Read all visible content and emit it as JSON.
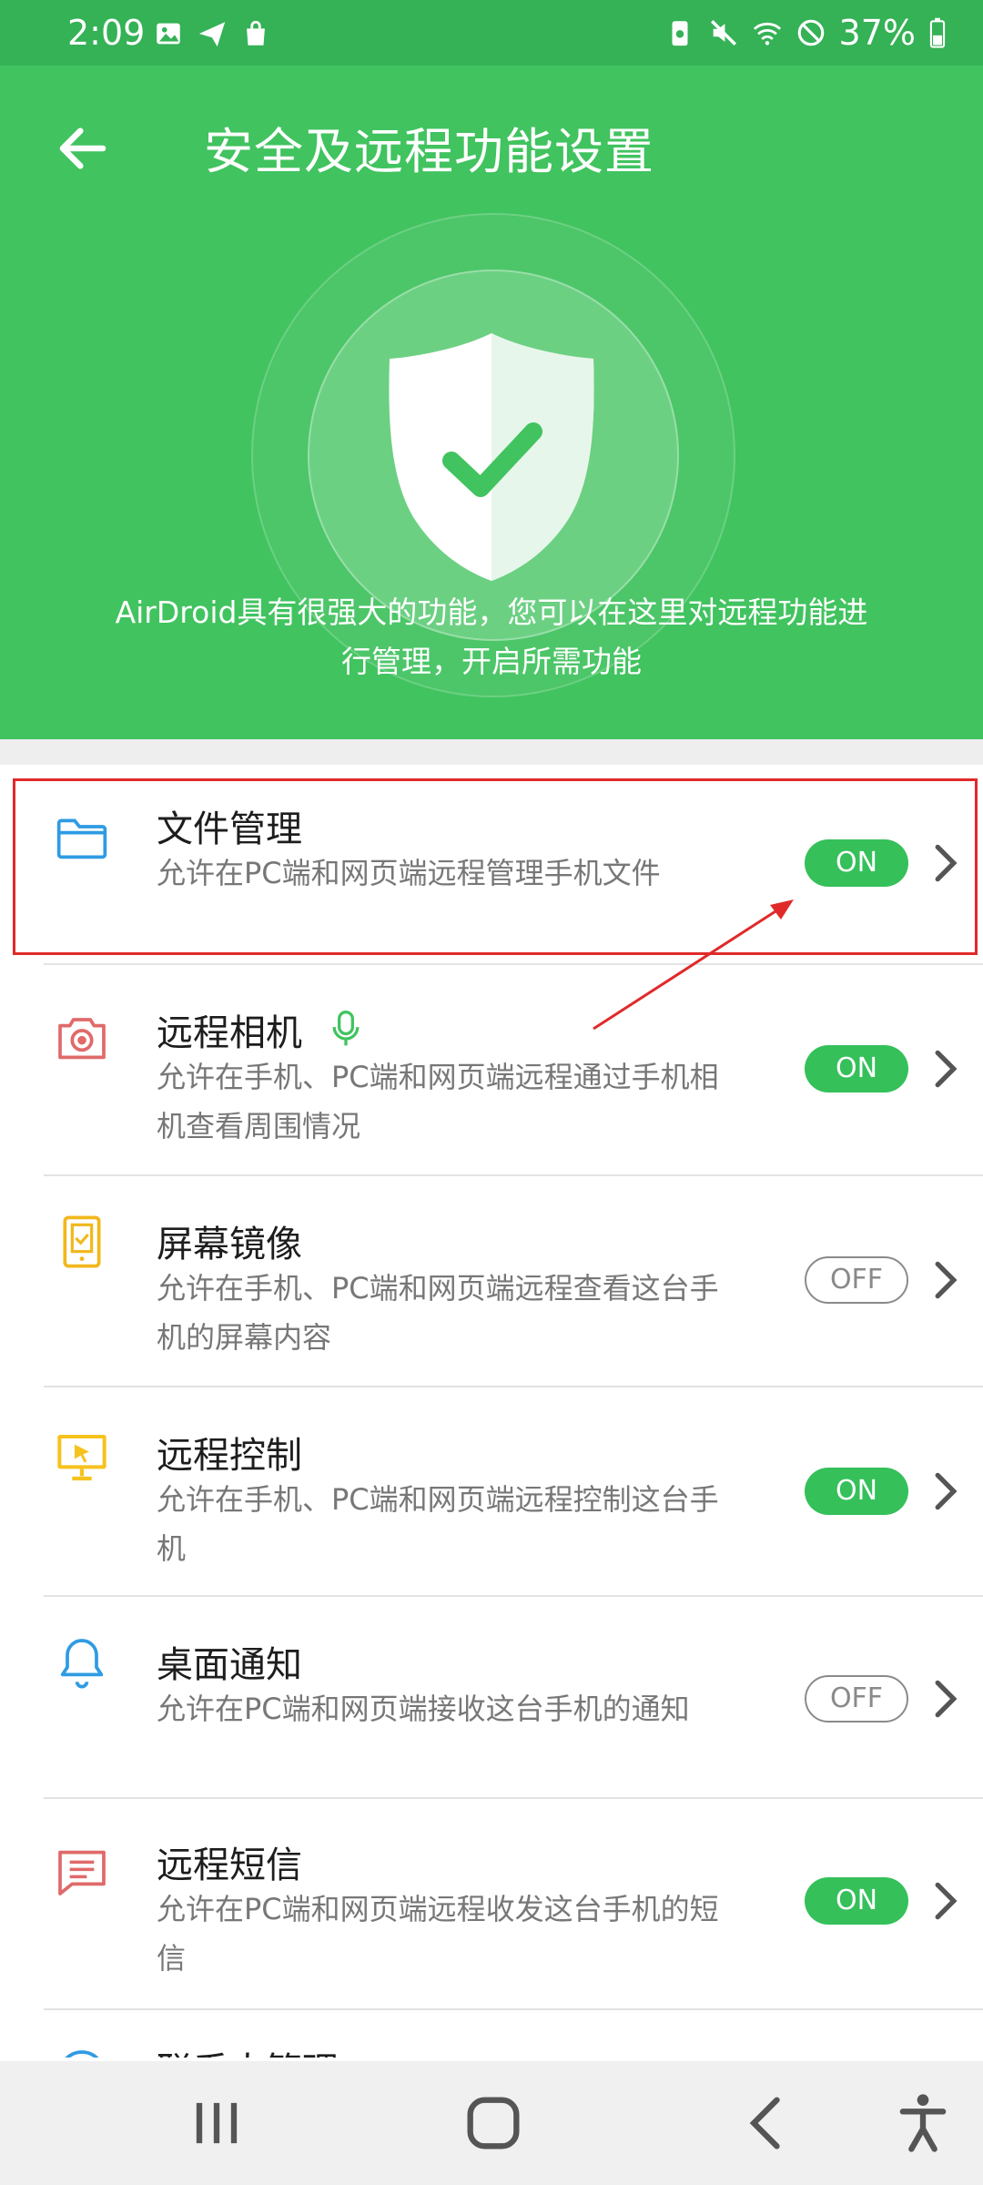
{
  "status_bar": {
    "time": "2:09",
    "battery": "37%"
  },
  "header": {
    "title": "安全及远程功能设置",
    "description_line1": "AirDroid具有很强大的功能，您可以在这里对远程功能进",
    "description_line2": "行管理，开启所需功能"
  },
  "items": [
    {
      "title": "文件管理",
      "desc1": "允许在PC端和网页端远程管理手机文件",
      "desc2": "",
      "toggle": "ON"
    },
    {
      "title": "远程相机",
      "desc1": "允许在手机、PC端和网页端远程通过手机相",
      "desc2": "机查看周围情况",
      "toggle": "ON"
    },
    {
      "title": "屏幕镜像",
      "desc1": "允许在手机、PC端和网页端远程查看这台手",
      "desc2": "机的屏幕内容",
      "toggle": "OFF"
    },
    {
      "title": "远程控制",
      "desc1": "允许在手机、PC端和网页端远程控制这台手",
      "desc2": "机",
      "toggle": "ON"
    },
    {
      "title": "桌面通知",
      "desc1": "允许在PC端和网页端接收这台手机的通知",
      "desc2": "",
      "toggle": "OFF"
    },
    {
      "title": "远程短信",
      "desc1": "允许在PC端和网页端远程收发这台手机的短",
      "desc2": "信",
      "toggle": "ON"
    },
    {
      "title": "联系人管理"
    }
  ],
  "colors": {
    "header_green": "#41c35f",
    "status_green": "#35b156",
    "toggle_on": "#35c05a",
    "highlight_red": "#e02a2a"
  }
}
